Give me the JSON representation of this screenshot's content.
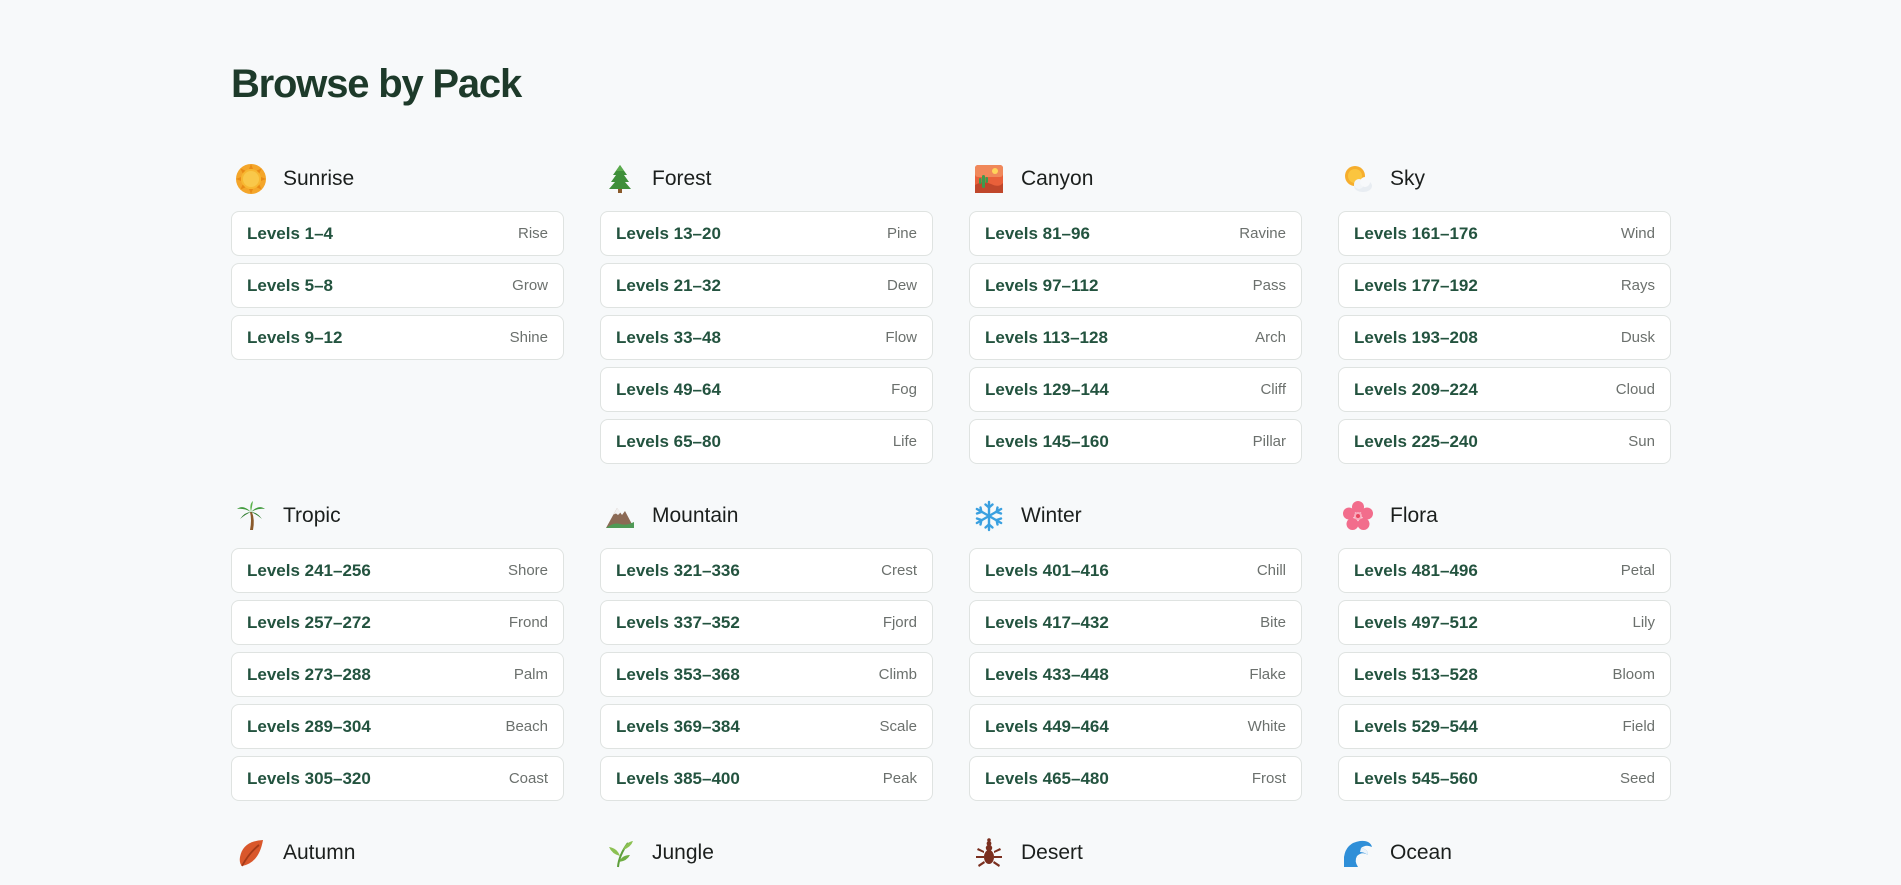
{
  "page": {
    "title": "Browse by Pack"
  },
  "packs": [
    {
      "name": "Sunrise",
      "icon": "sun-icon",
      "levels": [
        {
          "range": "Levels 1–4",
          "tag": "Rise"
        },
        {
          "range": "Levels 5–8",
          "tag": "Grow"
        },
        {
          "range": "Levels 9–12",
          "tag": "Shine"
        }
      ]
    },
    {
      "name": "Forest",
      "icon": "evergreen-tree-icon",
      "levels": [
        {
          "range": "Levels 13–20",
          "tag": "Pine"
        },
        {
          "range": "Levels 21–32",
          "tag": "Dew"
        },
        {
          "range": "Levels 33–48",
          "tag": "Flow"
        },
        {
          "range": "Levels 49–64",
          "tag": "Fog"
        },
        {
          "range": "Levels 65–80",
          "tag": "Life"
        }
      ]
    },
    {
      "name": "Canyon",
      "icon": "desert-landscape-icon",
      "levels": [
        {
          "range": "Levels 81–96",
          "tag": "Ravine"
        },
        {
          "range": "Levels 97–112",
          "tag": "Pass"
        },
        {
          "range": "Levels 113–128",
          "tag": "Arch"
        },
        {
          "range": "Levels 129–144",
          "tag": "Cliff"
        },
        {
          "range": "Levels 145–160",
          "tag": "Pillar"
        }
      ]
    },
    {
      "name": "Sky",
      "icon": "sun-behind-cloud-icon",
      "levels": [
        {
          "range": "Levels 161–176",
          "tag": "Wind"
        },
        {
          "range": "Levels 177–192",
          "tag": "Rays"
        },
        {
          "range": "Levels 193–208",
          "tag": "Dusk"
        },
        {
          "range": "Levels 209–224",
          "tag": "Cloud"
        },
        {
          "range": "Levels 225–240",
          "tag": "Sun"
        }
      ]
    },
    {
      "name": "Tropic",
      "icon": "palm-tree-icon",
      "levels": [
        {
          "range": "Levels 241–256",
          "tag": "Shore"
        },
        {
          "range": "Levels 257–272",
          "tag": "Frond"
        },
        {
          "range": "Levels 273–288",
          "tag": "Palm"
        },
        {
          "range": "Levels 289–304",
          "tag": "Beach"
        },
        {
          "range": "Levels 305–320",
          "tag": "Coast"
        }
      ]
    },
    {
      "name": "Mountain",
      "icon": "mountain-icon",
      "levels": [
        {
          "range": "Levels 321–336",
          "tag": "Crest"
        },
        {
          "range": "Levels 337–352",
          "tag": "Fjord"
        },
        {
          "range": "Levels 353–368",
          "tag": "Climb"
        },
        {
          "range": "Levels 369–384",
          "tag": "Scale"
        },
        {
          "range": "Levels 385–400",
          "tag": "Peak"
        }
      ]
    },
    {
      "name": "Winter",
      "icon": "snowflake-icon",
      "levels": [
        {
          "range": "Levels 401–416",
          "tag": "Chill"
        },
        {
          "range": "Levels 417–432",
          "tag": "Bite"
        },
        {
          "range": "Levels 433–448",
          "tag": "Flake"
        },
        {
          "range": "Levels 449–464",
          "tag": "White"
        },
        {
          "range": "Levels 465–480",
          "tag": "Frost"
        }
      ]
    },
    {
      "name": "Flora",
      "icon": "cherry-blossom-icon",
      "levels": [
        {
          "range": "Levels 481–496",
          "tag": "Petal"
        },
        {
          "range": "Levels 497–512",
          "tag": "Lily"
        },
        {
          "range": "Levels 513–528",
          "tag": "Bloom"
        },
        {
          "range": "Levels 529–544",
          "tag": "Field"
        },
        {
          "range": "Levels 545–560",
          "tag": "Seed"
        }
      ]
    },
    {
      "name": "Autumn",
      "icon": "fallen-leaf-icon",
      "levels": []
    },
    {
      "name": "Jungle",
      "icon": "herb-icon",
      "levels": []
    },
    {
      "name": "Desert",
      "icon": "scorpion-icon",
      "levels": []
    },
    {
      "name": "Ocean",
      "icon": "water-wave-icon",
      "levels": []
    }
  ]
}
